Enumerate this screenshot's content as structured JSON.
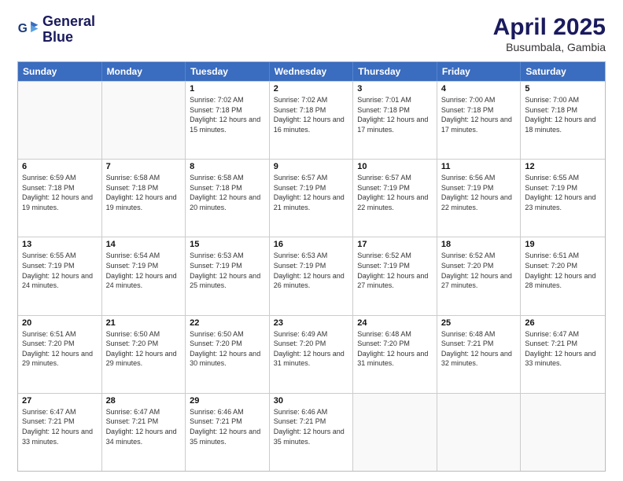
{
  "logo": {
    "line1": "General",
    "line2": "Blue"
  },
  "title": "April 2025",
  "subtitle": "Busumbala, Gambia",
  "headers": [
    "Sunday",
    "Monday",
    "Tuesday",
    "Wednesday",
    "Thursday",
    "Friday",
    "Saturday"
  ],
  "weeks": [
    [
      {
        "day": "",
        "info": ""
      },
      {
        "day": "",
        "info": ""
      },
      {
        "day": "1",
        "info": "Sunrise: 7:02 AM\nSunset: 7:18 PM\nDaylight: 12 hours and 15 minutes."
      },
      {
        "day": "2",
        "info": "Sunrise: 7:02 AM\nSunset: 7:18 PM\nDaylight: 12 hours and 16 minutes."
      },
      {
        "day": "3",
        "info": "Sunrise: 7:01 AM\nSunset: 7:18 PM\nDaylight: 12 hours and 17 minutes."
      },
      {
        "day": "4",
        "info": "Sunrise: 7:00 AM\nSunset: 7:18 PM\nDaylight: 12 hours and 17 minutes."
      },
      {
        "day": "5",
        "info": "Sunrise: 7:00 AM\nSunset: 7:18 PM\nDaylight: 12 hours and 18 minutes."
      }
    ],
    [
      {
        "day": "6",
        "info": "Sunrise: 6:59 AM\nSunset: 7:18 PM\nDaylight: 12 hours and 19 minutes."
      },
      {
        "day": "7",
        "info": "Sunrise: 6:58 AM\nSunset: 7:18 PM\nDaylight: 12 hours and 19 minutes."
      },
      {
        "day": "8",
        "info": "Sunrise: 6:58 AM\nSunset: 7:18 PM\nDaylight: 12 hours and 20 minutes."
      },
      {
        "day": "9",
        "info": "Sunrise: 6:57 AM\nSunset: 7:19 PM\nDaylight: 12 hours and 21 minutes."
      },
      {
        "day": "10",
        "info": "Sunrise: 6:57 AM\nSunset: 7:19 PM\nDaylight: 12 hours and 22 minutes."
      },
      {
        "day": "11",
        "info": "Sunrise: 6:56 AM\nSunset: 7:19 PM\nDaylight: 12 hours and 22 minutes."
      },
      {
        "day": "12",
        "info": "Sunrise: 6:55 AM\nSunset: 7:19 PM\nDaylight: 12 hours and 23 minutes."
      }
    ],
    [
      {
        "day": "13",
        "info": "Sunrise: 6:55 AM\nSunset: 7:19 PM\nDaylight: 12 hours and 24 minutes."
      },
      {
        "day": "14",
        "info": "Sunrise: 6:54 AM\nSunset: 7:19 PM\nDaylight: 12 hours and 24 minutes."
      },
      {
        "day": "15",
        "info": "Sunrise: 6:53 AM\nSunset: 7:19 PM\nDaylight: 12 hours and 25 minutes."
      },
      {
        "day": "16",
        "info": "Sunrise: 6:53 AM\nSunset: 7:19 PM\nDaylight: 12 hours and 26 minutes."
      },
      {
        "day": "17",
        "info": "Sunrise: 6:52 AM\nSunset: 7:19 PM\nDaylight: 12 hours and 27 minutes."
      },
      {
        "day": "18",
        "info": "Sunrise: 6:52 AM\nSunset: 7:20 PM\nDaylight: 12 hours and 27 minutes."
      },
      {
        "day": "19",
        "info": "Sunrise: 6:51 AM\nSunset: 7:20 PM\nDaylight: 12 hours and 28 minutes."
      }
    ],
    [
      {
        "day": "20",
        "info": "Sunrise: 6:51 AM\nSunset: 7:20 PM\nDaylight: 12 hours and 29 minutes."
      },
      {
        "day": "21",
        "info": "Sunrise: 6:50 AM\nSunset: 7:20 PM\nDaylight: 12 hours and 29 minutes."
      },
      {
        "day": "22",
        "info": "Sunrise: 6:50 AM\nSunset: 7:20 PM\nDaylight: 12 hours and 30 minutes."
      },
      {
        "day": "23",
        "info": "Sunrise: 6:49 AM\nSunset: 7:20 PM\nDaylight: 12 hours and 31 minutes."
      },
      {
        "day": "24",
        "info": "Sunrise: 6:48 AM\nSunset: 7:20 PM\nDaylight: 12 hours and 31 minutes."
      },
      {
        "day": "25",
        "info": "Sunrise: 6:48 AM\nSunset: 7:21 PM\nDaylight: 12 hours and 32 minutes."
      },
      {
        "day": "26",
        "info": "Sunrise: 6:47 AM\nSunset: 7:21 PM\nDaylight: 12 hours and 33 minutes."
      }
    ],
    [
      {
        "day": "27",
        "info": "Sunrise: 6:47 AM\nSunset: 7:21 PM\nDaylight: 12 hours and 33 minutes."
      },
      {
        "day": "28",
        "info": "Sunrise: 6:47 AM\nSunset: 7:21 PM\nDaylight: 12 hours and 34 minutes."
      },
      {
        "day": "29",
        "info": "Sunrise: 6:46 AM\nSunset: 7:21 PM\nDaylight: 12 hours and 35 minutes."
      },
      {
        "day": "30",
        "info": "Sunrise: 6:46 AM\nSunset: 7:21 PM\nDaylight: 12 hours and 35 minutes."
      },
      {
        "day": "",
        "info": ""
      },
      {
        "day": "",
        "info": ""
      },
      {
        "day": "",
        "info": ""
      }
    ]
  ]
}
